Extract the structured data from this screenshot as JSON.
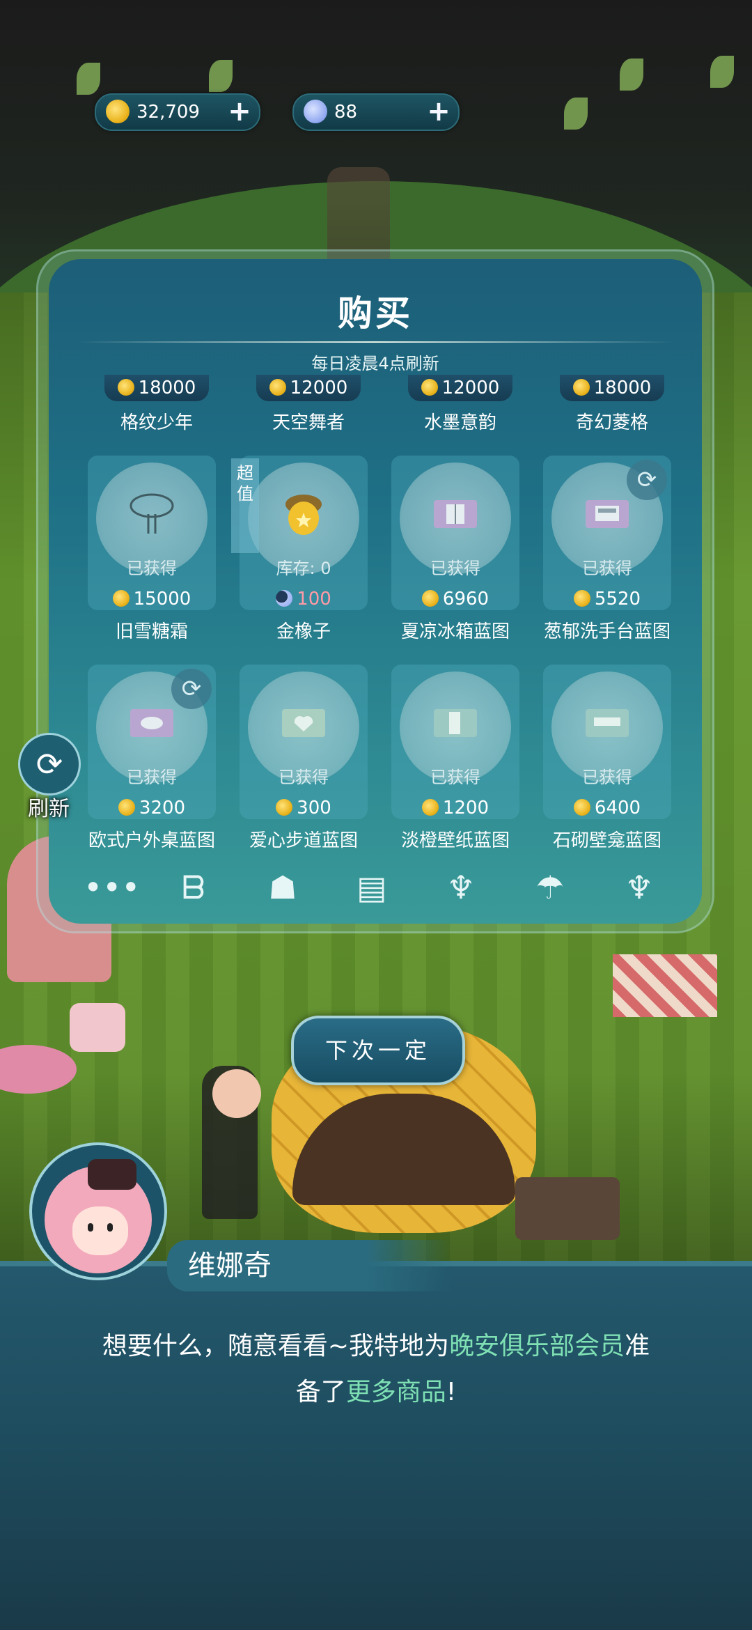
{
  "currency": {
    "coins": "32,709",
    "moons": "88",
    "plus_symbol": "+"
  },
  "shop": {
    "title": "购买",
    "subtitle": "每日凌晨4点刷新",
    "top_row": [
      {
        "price": "18000",
        "name": "格纹少年"
      },
      {
        "price": "12000",
        "name": "天空舞者"
      },
      {
        "price": "12000",
        "name": "水墨意韵"
      },
      {
        "price": "18000",
        "name": "奇幻菱格"
      }
    ],
    "row2": [
      {
        "status": "已获得",
        "price": "15000",
        "name": "旧雪糖霜",
        "currency": "coin"
      },
      {
        "status": "库存: 0",
        "price": "100",
        "name": "金橡子",
        "currency": "moon",
        "tag": "超值"
      },
      {
        "status": "已获得",
        "price": "6960",
        "name": "夏凉冰箱蓝图",
        "currency": "coin"
      },
      {
        "status": "已获得",
        "price": "5520",
        "name": "葱郁洗手台蓝图",
        "currency": "coin"
      }
    ],
    "row3": [
      {
        "status": "已获得",
        "price": "3200",
        "name": "欧式户外桌蓝图",
        "currency": "coin"
      },
      {
        "status": "已获得",
        "price": "300",
        "name": "爱心步道蓝图",
        "currency": "coin"
      },
      {
        "status": "已获得",
        "price": "1200",
        "name": "淡橙壁纸蓝图",
        "currency": "coin"
      },
      {
        "status": "已获得",
        "price": "6400",
        "name": "石砌壁龛蓝图",
        "currency": "coin"
      }
    ],
    "categories": [
      "more-icon",
      "gesture-icon",
      "bag-icon",
      "blueprint-icon",
      "lamp-icon",
      "umbrella-icon",
      "clothes-icon"
    ],
    "category_glyphs": [
      "•••",
      "ᗷ",
      "☗",
      "▤",
      "♆",
      "☂",
      "♆"
    ]
  },
  "side": {
    "refresh_label": "刷新",
    "refresh_glyph": "⟳"
  },
  "next_button": "下次一定",
  "dialog": {
    "speaker": "维娜奇",
    "line1_a": "想要什么，随意看看~我特地为",
    "line1_hl": "晚安俱乐部会员",
    "line1_b": "准",
    "line2_a": "备了",
    "line2_hl": "更多商品",
    "line2_b": "!"
  },
  "colors": {
    "accent_green": "#7fe0b4",
    "panel_top": "#1d5e78",
    "coin_gold": "#e9b21a"
  }
}
